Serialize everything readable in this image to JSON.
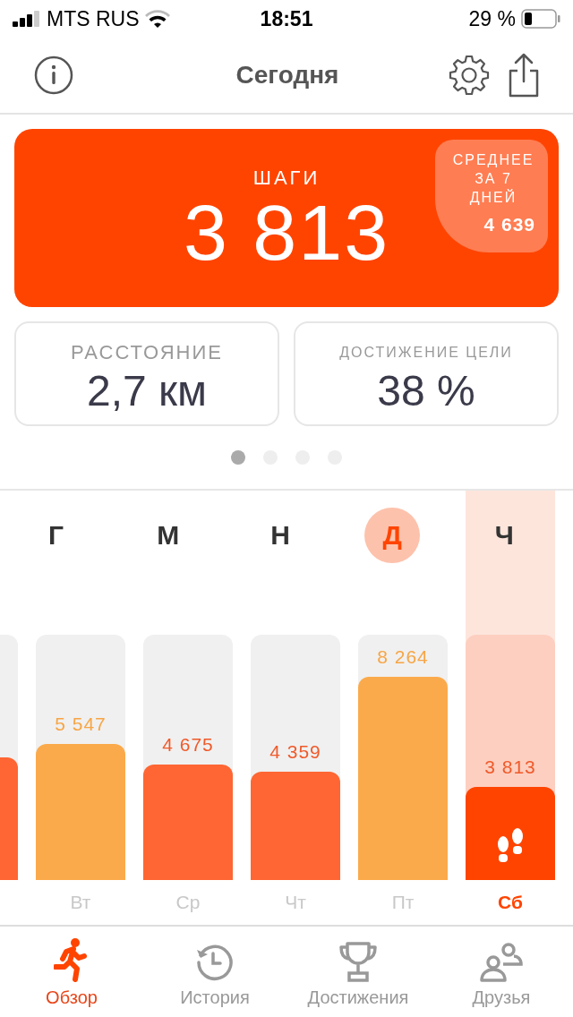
{
  "status_bar": {
    "carrier": "MTS RUS",
    "time": "18:51",
    "battery": "29 %"
  },
  "nav": {
    "title": "Сегодня"
  },
  "steps_card": {
    "label": "ШАГИ",
    "value": "3 813",
    "average": {
      "label": "СРЕДНЕЕ ЗА 7 ДНЕЙ",
      "value": "4 639"
    }
  },
  "stats": [
    {
      "label": "РАССТОЯНИЕ",
      "value": "2,7 км",
      "kind": "large"
    },
    {
      "label": "ДОСТИЖЕНИЕ ЦЕЛИ",
      "value": "38 %",
      "kind": "small"
    }
  ],
  "pager": [
    {
      "selected": true
    },
    {
      "selected": false
    },
    {
      "selected": false
    },
    {
      "selected": false
    }
  ],
  "letters": [
    {
      "text": "Г",
      "selected": false
    },
    {
      "text": "М",
      "selected": false
    },
    {
      "text": "Н",
      "selected": false
    },
    {
      "text": "Д",
      "selected": true
    },
    {
      "text": "Ч",
      "selected": false
    }
  ],
  "bars": [
    {
      "level": 0.5,
      "color": "#ff6633",
      "selected": false
    },
    {
      "day": "Вт",
      "value": "5 547",
      "level": 0.555,
      "color": "#fbaa4b",
      "selected": false
    },
    {
      "day": "Ср",
      "value": "4 675",
      "level": 0.47,
      "color": "#ff6633",
      "selected": false
    },
    {
      "day": "Чт",
      "value": "4 359",
      "level": 0.44,
      "color": "#ff6633",
      "selected": false
    },
    {
      "day": "Пт",
      "value": "8 264",
      "level": 0.83,
      "color": "#fbaa4b",
      "selected": false
    },
    {
      "day": "Сб",
      "value": "3 813",
      "level": 0.38,
      "color": "#ff4400",
      "selected": true
    }
  ],
  "tabs": [
    {
      "label": "Обзор",
      "selected": true
    },
    {
      "label": "История",
      "selected": false
    },
    {
      "label": "Достижения",
      "selected": false
    },
    {
      "label": "Друзья",
      "selected": false
    }
  ]
}
